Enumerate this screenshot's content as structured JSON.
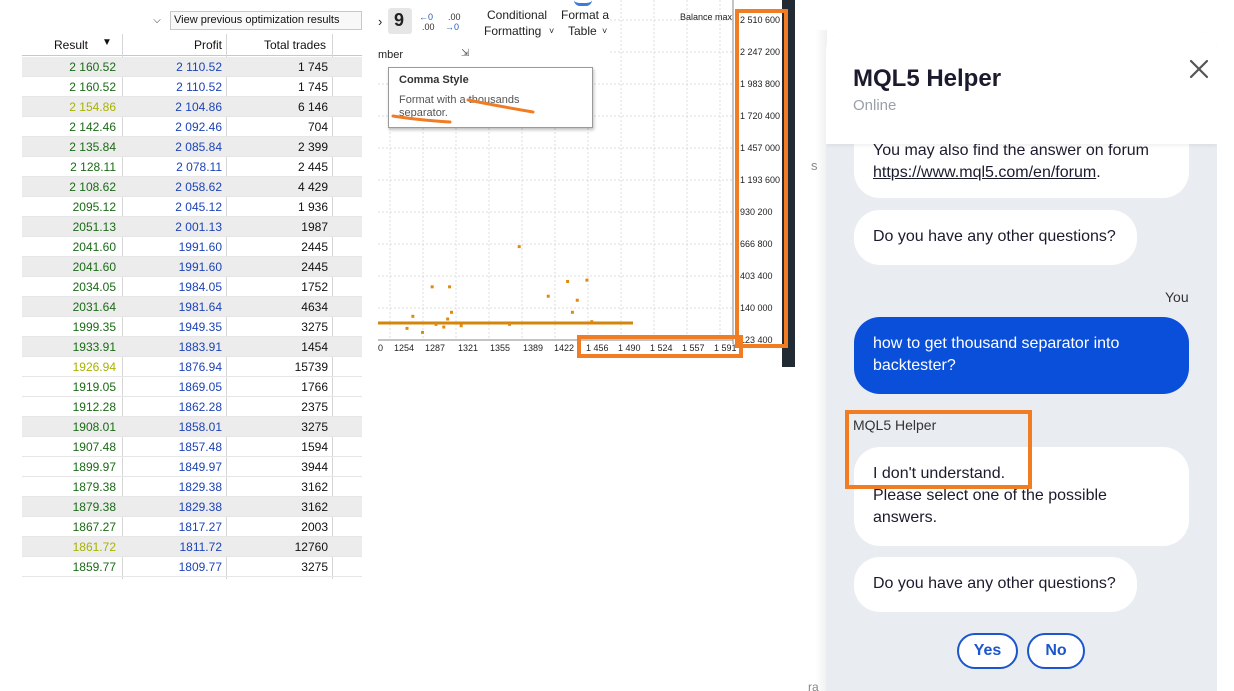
{
  "optimization": {
    "view_previous": "View previous optimization results",
    "columns": {
      "result": "Result",
      "profit": "Profit",
      "total_trades": "Total trades"
    },
    "rows": [
      {
        "result": "2 160.52",
        "profit": "2 110.52",
        "trades": "1 745",
        "shade": true,
        "olive": false
      },
      {
        "result": "2 160.52",
        "profit": "2 110.52",
        "trades": "1 745",
        "shade": false,
        "olive": false
      },
      {
        "result": "2 154.86",
        "profit": "2 104.86",
        "trades": "6 146",
        "shade": true,
        "olive": true
      },
      {
        "result": "2 142.46",
        "profit": "2 092.46",
        "trades": "704",
        "shade": false,
        "olive": false
      },
      {
        "result": "2 135.84",
        "profit": "2 085.84",
        "trades": "2 399",
        "shade": true,
        "olive": false
      },
      {
        "result": "2 128.11",
        "profit": "2 078.11",
        "trades": "2 445",
        "shade": false,
        "olive": false
      },
      {
        "result": "2 108.62",
        "profit": "2 058.62",
        "trades": "4 429",
        "shade": true,
        "olive": false
      },
      {
        "result": "2095.12",
        "profit": "2 045.12",
        "trades": "1 936",
        "shade": false,
        "olive": false
      },
      {
        "result": "2051.13",
        "profit": "2 001.13",
        "trades": "1987",
        "shade": true,
        "olive": false
      },
      {
        "result": "2041.60",
        "profit": "1991.60",
        "trades": "2445",
        "shade": false,
        "olive": false
      },
      {
        "result": "2041.60",
        "profit": "1991.60",
        "trades": "2445",
        "shade": true,
        "olive": false
      },
      {
        "result": "2034.05",
        "profit": "1984.05",
        "trades": "1752",
        "shade": false,
        "olive": false
      },
      {
        "result": "2031.64",
        "profit": "1981.64",
        "trades": "4634",
        "shade": true,
        "olive": false
      },
      {
        "result": "1999.35",
        "profit": "1949.35",
        "trades": "3275",
        "shade": false,
        "olive": false
      },
      {
        "result": "1933.91",
        "profit": "1883.91",
        "trades": "1454",
        "shade": true,
        "olive": false
      },
      {
        "result": "1926.94",
        "profit": "1876.94",
        "trades": "15739",
        "shade": false,
        "olive": true
      },
      {
        "result": "1919.05",
        "profit": "1869.05",
        "trades": "1766",
        "shade": false,
        "olive": false
      },
      {
        "result": "1912.28",
        "profit": "1862.28",
        "trades": "2375",
        "shade": false,
        "olive": false
      },
      {
        "result": "1908.01",
        "profit": "1858.01",
        "trades": "3275",
        "shade": true,
        "olive": false
      },
      {
        "result": "1907.48",
        "profit": "1857.48",
        "trades": "1594",
        "shade": false,
        "olive": false
      },
      {
        "result": "1899.97",
        "profit": "1849.97",
        "trades": "3944",
        "shade": false,
        "olive": false
      },
      {
        "result": "1879.38",
        "profit": "1829.38",
        "trades": "3162",
        "shade": false,
        "olive": false
      },
      {
        "result": "1879.38",
        "profit": "1829.38",
        "trades": "3162",
        "shade": true,
        "olive": false
      },
      {
        "result": "1867.27",
        "profit": "1817.27",
        "trades": "2003",
        "shade": false,
        "olive": false
      },
      {
        "result": "1861.72",
        "profit": "1811.72",
        "trades": "12760",
        "shade": true,
        "olive": true
      },
      {
        "result": "1859.77",
        "profit": "1809.77",
        "trades": "3275",
        "shade": false,
        "olive": false
      }
    ]
  },
  "ribbon": {
    "comma_glyph": "9",
    "conditional_1": "Conditional",
    "conditional_2": "Formatting",
    "format_as_1": "Format a",
    "format_as_2": "Table",
    "number_group": "mber",
    "tooltip_title": "Comma Style",
    "tooltip_body": "Format with a thousands separator."
  },
  "chart_data": {
    "type": "scatter",
    "title": "Balance max",
    "y_ticks": [
      "2 510 600",
      "2 247 200",
      "1 983 800",
      "1 720 400",
      "1 457 000",
      "1 193 600",
      "930 200",
      "666 800",
      "403 400",
      "140 000",
      "123 400"
    ],
    "x_ticks": [
      "0",
      "1254",
      "1287",
      "1321",
      "1355",
      "1389",
      "1422",
      "1 456",
      "1 490",
      "1 524",
      "1 557",
      "1 591"
    ],
    "points": [
      {
        "x": 1254,
        "y": 210000
      },
      {
        "x": 1260,
        "y": 300000
      },
      {
        "x": 1270,
        "y": 180000
      },
      {
        "x": 1280,
        "y": 520000
      },
      {
        "x": 1284,
        "y": 240000
      },
      {
        "x": 1292,
        "y": 220000
      },
      {
        "x": 1296,
        "y": 280000
      },
      {
        "x": 1298,
        "y": 520000
      },
      {
        "x": 1300,
        "y": 330000
      },
      {
        "x": 1310,
        "y": 230000
      },
      {
        "x": 1360,
        "y": 240000
      },
      {
        "x": 1370,
        "y": 820000
      },
      {
        "x": 1400,
        "y": 450000
      },
      {
        "x": 1420,
        "y": 560000
      },
      {
        "x": 1425,
        "y": 330000
      },
      {
        "x": 1430,
        "y": 420000
      },
      {
        "x": 1440,
        "y": 570000
      },
      {
        "x": 1445,
        "y": 260000
      }
    ],
    "xlim": [
      1224,
      1591
    ],
    "ylim": [
      123400,
      2510600
    ]
  },
  "chat": {
    "title": "MQL5 Helper",
    "status": "Online",
    "forum_text": "You may also find the answer on forum",
    "forum_link": "https://www.mql5.com/en/forum",
    "forum_dot": ".",
    "question_1": "Do you have any other questions?",
    "you_label": "You",
    "user_message": "how to get thousand separator into backtester?",
    "bot_label": "MQL5 Helper",
    "bot_reply_1": "I don't understand.",
    "bot_reply_2": "Please select one of the possible answers.",
    "question_2": "Do you have any other questions?",
    "yes": "Yes",
    "no": "No"
  },
  "colors": {
    "accent_blue": "#0a4fd9",
    "annotation_orange": "#f07c23",
    "profit_blue": "#1b43b8",
    "result_green": "#1a6a16"
  }
}
